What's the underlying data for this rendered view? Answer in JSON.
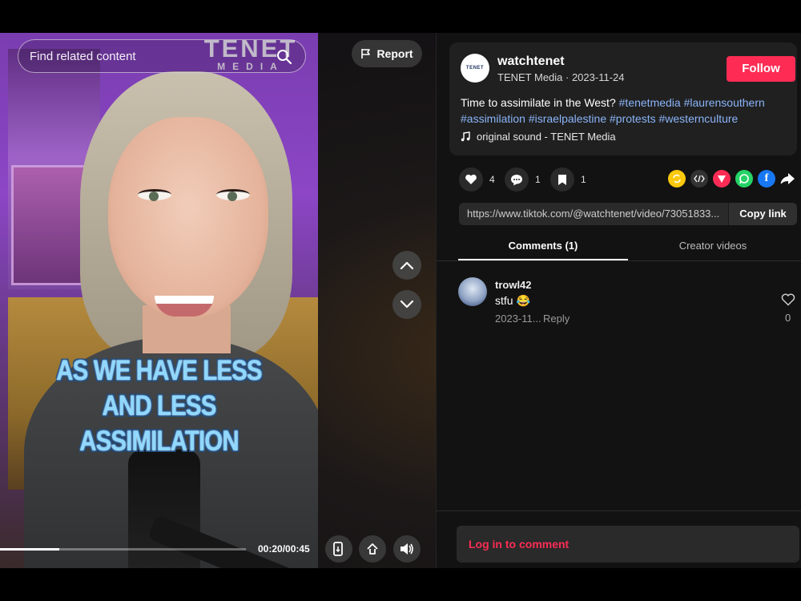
{
  "video": {
    "search_placeholder": "Find related content",
    "logo_main": "TENET",
    "logo_sub": "MEDIA",
    "report_label": "Report",
    "caption_line1": "AS WE HAVE LESS",
    "caption_line2": "AND LESS ASSIMILATION",
    "time": "00:20/00:45",
    "progress_fraction": 0.24
  },
  "author": {
    "avatar_text": "TENET",
    "username": "watchtenet",
    "meta": "TENET Media · 2023-11-24",
    "follow_label": "Follow"
  },
  "post": {
    "description_text": "Time to assimilate in the West? ",
    "hashtags": [
      "#tenetmedia",
      "#laurensouthern",
      "#assimilation",
      "#israelpalestine",
      "#protests",
      "#westernculture"
    ],
    "sound": "original sound - TENET Media"
  },
  "actions": {
    "likes": "4",
    "comments": "1",
    "saves": "1",
    "facebook_glyph": "f"
  },
  "link": {
    "url": "https://www.tiktok.com/@watchtenet/video/73051833...",
    "copy_label": "Copy link"
  },
  "tabs": {
    "comments_label": "Comments (1)",
    "creator_label": "Creator videos"
  },
  "comment": {
    "user": "trowl42",
    "text": "stfu 😂",
    "date": "2023-11...",
    "reply_label": "Reply",
    "likes": "0"
  },
  "footer": {
    "login_label": "Log in to comment"
  },
  "colors": {
    "accent": "#fe2c55",
    "hashtag": "#8ab4f8",
    "panel_bg": "#121212"
  }
}
